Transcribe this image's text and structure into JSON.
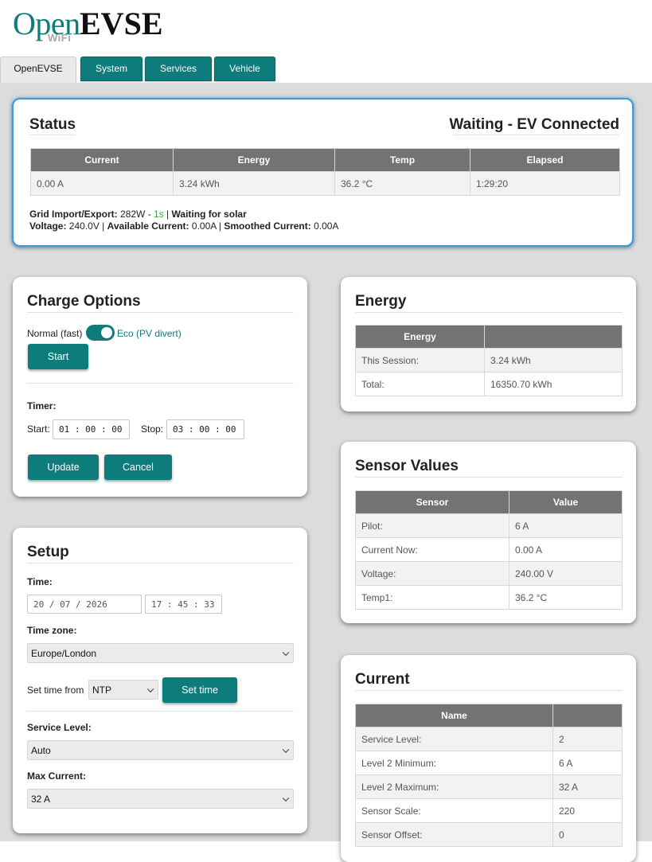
{
  "logo": {
    "open": "Open",
    "evse": "EVSE",
    "wifi": "WiFi"
  },
  "tabs": [
    {
      "label": "OpenEVSE"
    },
    {
      "label": "System"
    },
    {
      "label": "Services"
    },
    {
      "label": "Vehicle"
    }
  ],
  "status": {
    "title": "Status",
    "state": "Waiting - EV Connected",
    "headers": [
      "Current",
      "Energy",
      "Temp",
      "Elapsed"
    ],
    "values": [
      "0.00 A",
      "3.24 kWh",
      "36.2 °C",
      "1:29:20"
    ],
    "grid_label": "Grid Import/Export:",
    "grid_value": "282W - ",
    "grid_age": "1s",
    "grid_sep": " | ",
    "grid_state": "Waiting for solar",
    "voltage_label": "Voltage:",
    "voltage_value": "240.0V | ",
    "available_label": "Available Current:",
    "available_value": "0.00A | ",
    "smoothed_label": "Smoothed Current:",
    "smoothed_value": "0.00A",
    "colors": {
      "border": "#3a9ad9",
      "age": "#3aa63a"
    }
  },
  "charge_options": {
    "title": "Charge Options",
    "mode_normal": "Normal (fast)",
    "mode_eco": "Eco (PV divert)",
    "eco_enabled": true,
    "start_button": "Start",
    "timer_label": "Timer:",
    "start_label": "Start:",
    "start_value": "01 : 00 : 00",
    "stop_label": "Stop:",
    "stop_value": "03 : 00 : 00",
    "update_button": "Update",
    "cancel_button": "Cancel"
  },
  "setup": {
    "title": "Setup",
    "time_label": "Time:",
    "date_value": "20 / 07 / 2026",
    "time_value": "17 : 45 : 33",
    "timezone_label": "Time zone:",
    "timezone_value": "Europe/London",
    "set_time_from_label": "Set time from",
    "set_time_from_value": "NTP",
    "set_time_button": "Set time",
    "service_level_label": "Service Level:",
    "service_level_value": "Auto",
    "max_current_label": "Max Current:",
    "max_current_value": "32 A"
  },
  "energy": {
    "title": "Energy",
    "headers": [
      "Energy",
      ""
    ],
    "rows": [
      [
        "This Session:",
        "3.24 kWh"
      ],
      [
        "Total:",
        "16350.70 kWh"
      ]
    ]
  },
  "sensors": {
    "title": "Sensor Values",
    "headers": [
      "Sensor",
      "Value"
    ],
    "rows": [
      [
        "Pilot:",
        "6 A"
      ],
      [
        "Current Now:",
        "0.00 A"
      ],
      [
        "Voltage:",
        "240.00 V"
      ],
      [
        "Temp1:",
        "36.2 °C"
      ]
    ]
  },
  "current": {
    "title": "Current",
    "headers": [
      "Name",
      ""
    ],
    "rows": [
      [
        "Service Level:",
        "2"
      ],
      [
        "Level 2 Minimum:",
        "6 A"
      ],
      [
        "Level 2 Maximum:",
        "32 A"
      ],
      [
        "Sensor Scale:",
        "220"
      ],
      [
        "Sensor Offset:",
        "0"
      ]
    ]
  },
  "colors": {
    "accent": "#0e7c7b",
    "header": "#737373",
    "background": "#dcdcdc"
  }
}
